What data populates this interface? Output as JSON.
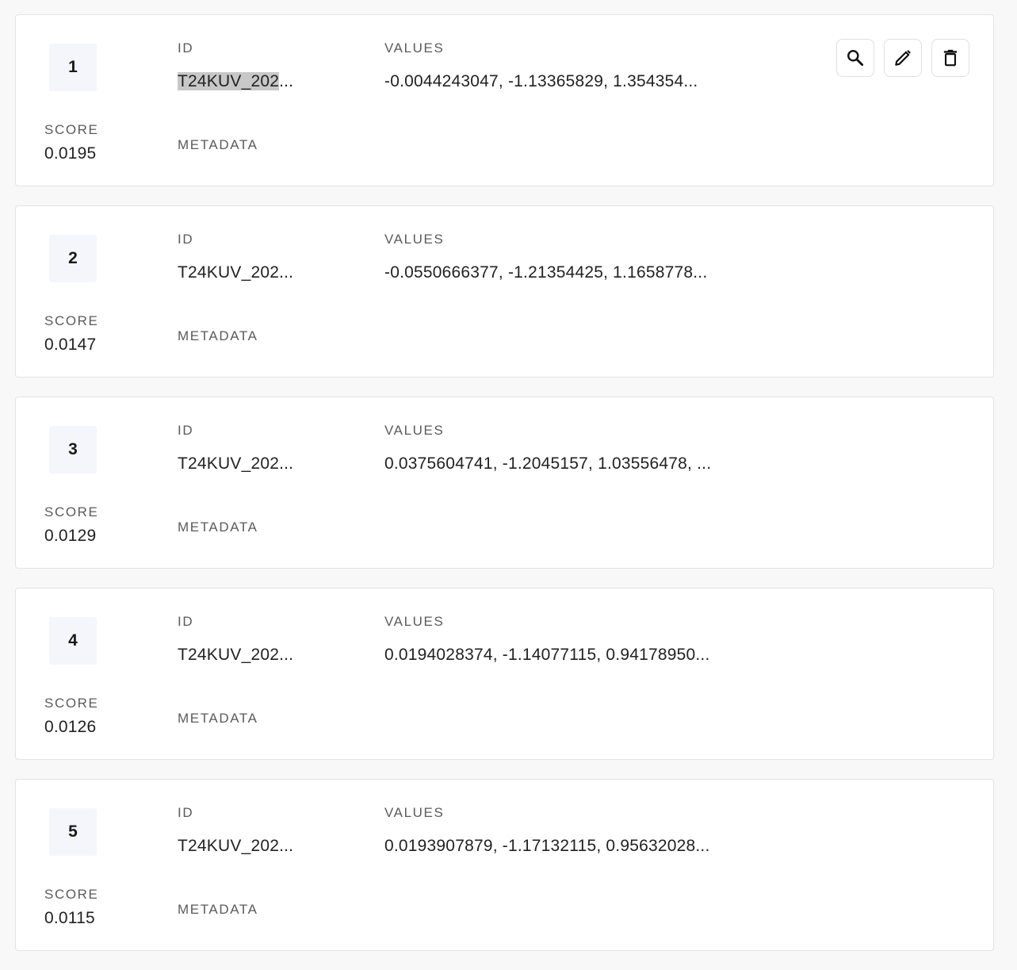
{
  "labels": {
    "score": "SCORE",
    "id": "ID",
    "values": "VALUES",
    "metadata": "METADATA"
  },
  "results": [
    {
      "rank": "1",
      "score": "0.0195",
      "id_selected_part": "T24KUV_202",
      "id_rest": "...",
      "values": "-0.0044243047, -1.13365829, 1.354354..."
    },
    {
      "rank": "2",
      "score": "0.0147",
      "id": "T24KUV_202...",
      "values": "-0.0550666377, -1.21354425, 1.1658778..."
    },
    {
      "rank": "3",
      "score": "0.0129",
      "id": "T24KUV_202...",
      "values": "0.0375604741, -1.2045157, 1.03556478, ..."
    },
    {
      "rank": "4",
      "score": "0.0126",
      "id": "T24KUV_202...",
      "values": "0.0194028374, -1.14077115, 0.94178950..."
    },
    {
      "rank": "5",
      "score": "0.0115",
      "id": "T24KUV_202...",
      "values": "0.0193907879, -1.17132115, 0.95632028..."
    }
  ],
  "actions": {
    "icons": [
      "search-icon",
      "edit-icon",
      "delete-icon"
    ]
  }
}
